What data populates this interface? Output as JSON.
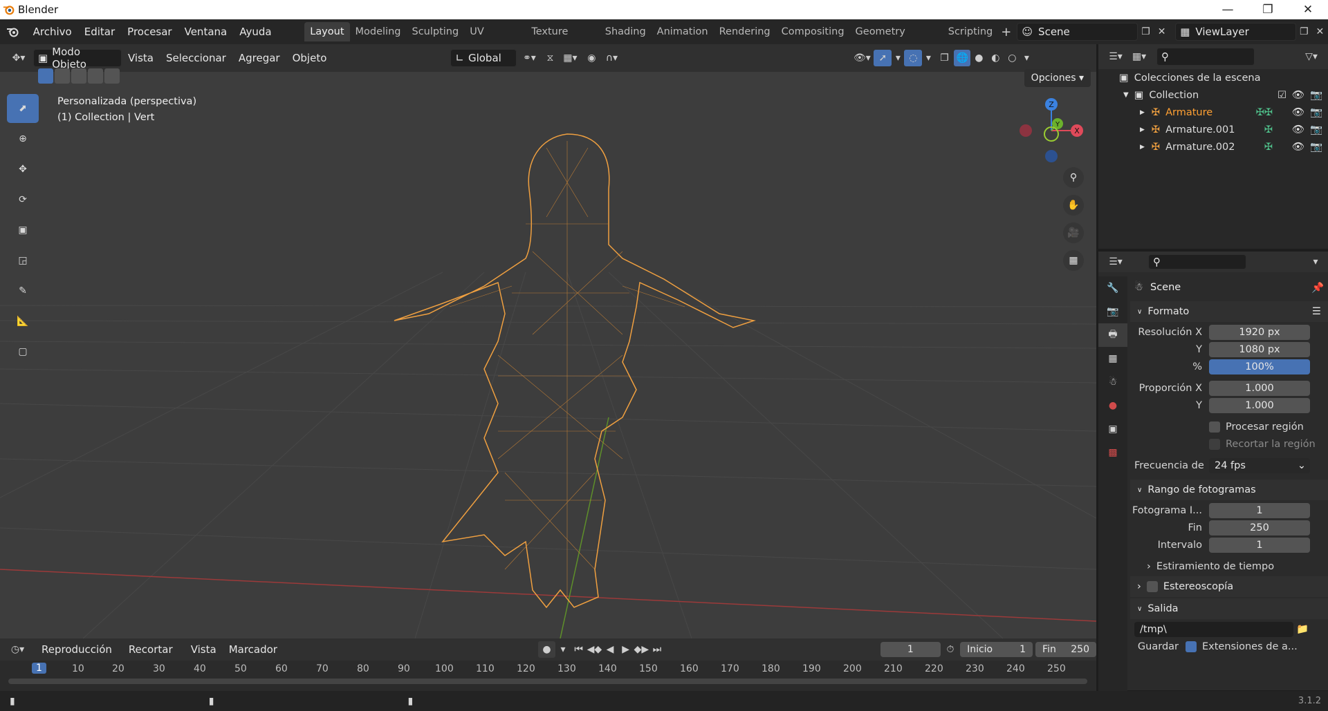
{
  "window": {
    "title": "Blender"
  },
  "menu": [
    "Archivo",
    "Editar",
    "Procesar",
    "Ventana",
    "Ayuda"
  ],
  "workspaces": [
    "Layout",
    "Modeling",
    "Sculpting",
    "UV Editing",
    "Texture Paint",
    "Shading",
    "Animation",
    "Rendering",
    "Compositing",
    "Geometry Nodes",
    "Scripting"
  ],
  "scene_name": "Scene",
  "view_layer": "ViewLayer",
  "viewport_header": {
    "mode": "Modo Objeto",
    "menus": [
      "Vista",
      "Seleccionar",
      "Agregar",
      "Objeto"
    ],
    "transform_orientation": "Global",
    "options": "Opciones"
  },
  "viewport_info": {
    "line1": "Personalizada (perspectiva)",
    "line2": "(1) Collection | Vert"
  },
  "gizmo": {
    "z": "Z",
    "y": "Y",
    "x": "X"
  },
  "outliner": {
    "title": "Colecciones de la escena",
    "collection": "Collection",
    "items": [
      "Armature",
      "Armature.001",
      "Armature.002"
    ]
  },
  "properties": {
    "context": "Scene",
    "formato": {
      "title": "Formato",
      "res_x_label": "Resolución X",
      "res_x": "1920 px",
      "res_y_label": "Y",
      "res_y": "1080 px",
      "pct_label": "%",
      "pct": "100%",
      "aspect_x_label": "Proporción X",
      "aspect_x": "1.000",
      "aspect_y_label": "Y",
      "aspect_y": "1.000",
      "render_region": "Procesar región",
      "crop_region": "Recortar la región",
      "fps_label": "Frecuencia de",
      "fps": "24 fps"
    },
    "frame_range": {
      "title": "Rango de fotogramas",
      "start_label": "Fotograma I...",
      "start": "1",
      "end_label": "Fin",
      "end": "250",
      "step_label": "Intervalo",
      "step": "1",
      "time_stretch": "Estiramiento de tiempo"
    },
    "stereo": "Estereoscopía",
    "output": {
      "title": "Salida",
      "path": "/tmp\\",
      "save_label": "Guardar",
      "file_ext": "Extensiones de a..."
    }
  },
  "timeline": {
    "menus": [
      "Reproducción",
      "Recortar",
      "Vista",
      "Marcador"
    ],
    "current_frame": "1",
    "start_label": "Inicio",
    "start": "1",
    "end_label": "Fin",
    "end": "250",
    "ticks": [
      "1",
      "10",
      "20",
      "30",
      "40",
      "50",
      "60",
      "70",
      "80",
      "90",
      "100",
      "110",
      "120",
      "130",
      "140",
      "150",
      "160",
      "170",
      "180",
      "190",
      "200",
      "210",
      "220",
      "230",
      "240",
      "250"
    ]
  },
  "status": {
    "version": "3.1.2"
  },
  "colors": {
    "accent": "#4772b3",
    "selection_orange": "#f0a040",
    "active_orange": "#ffa033"
  }
}
